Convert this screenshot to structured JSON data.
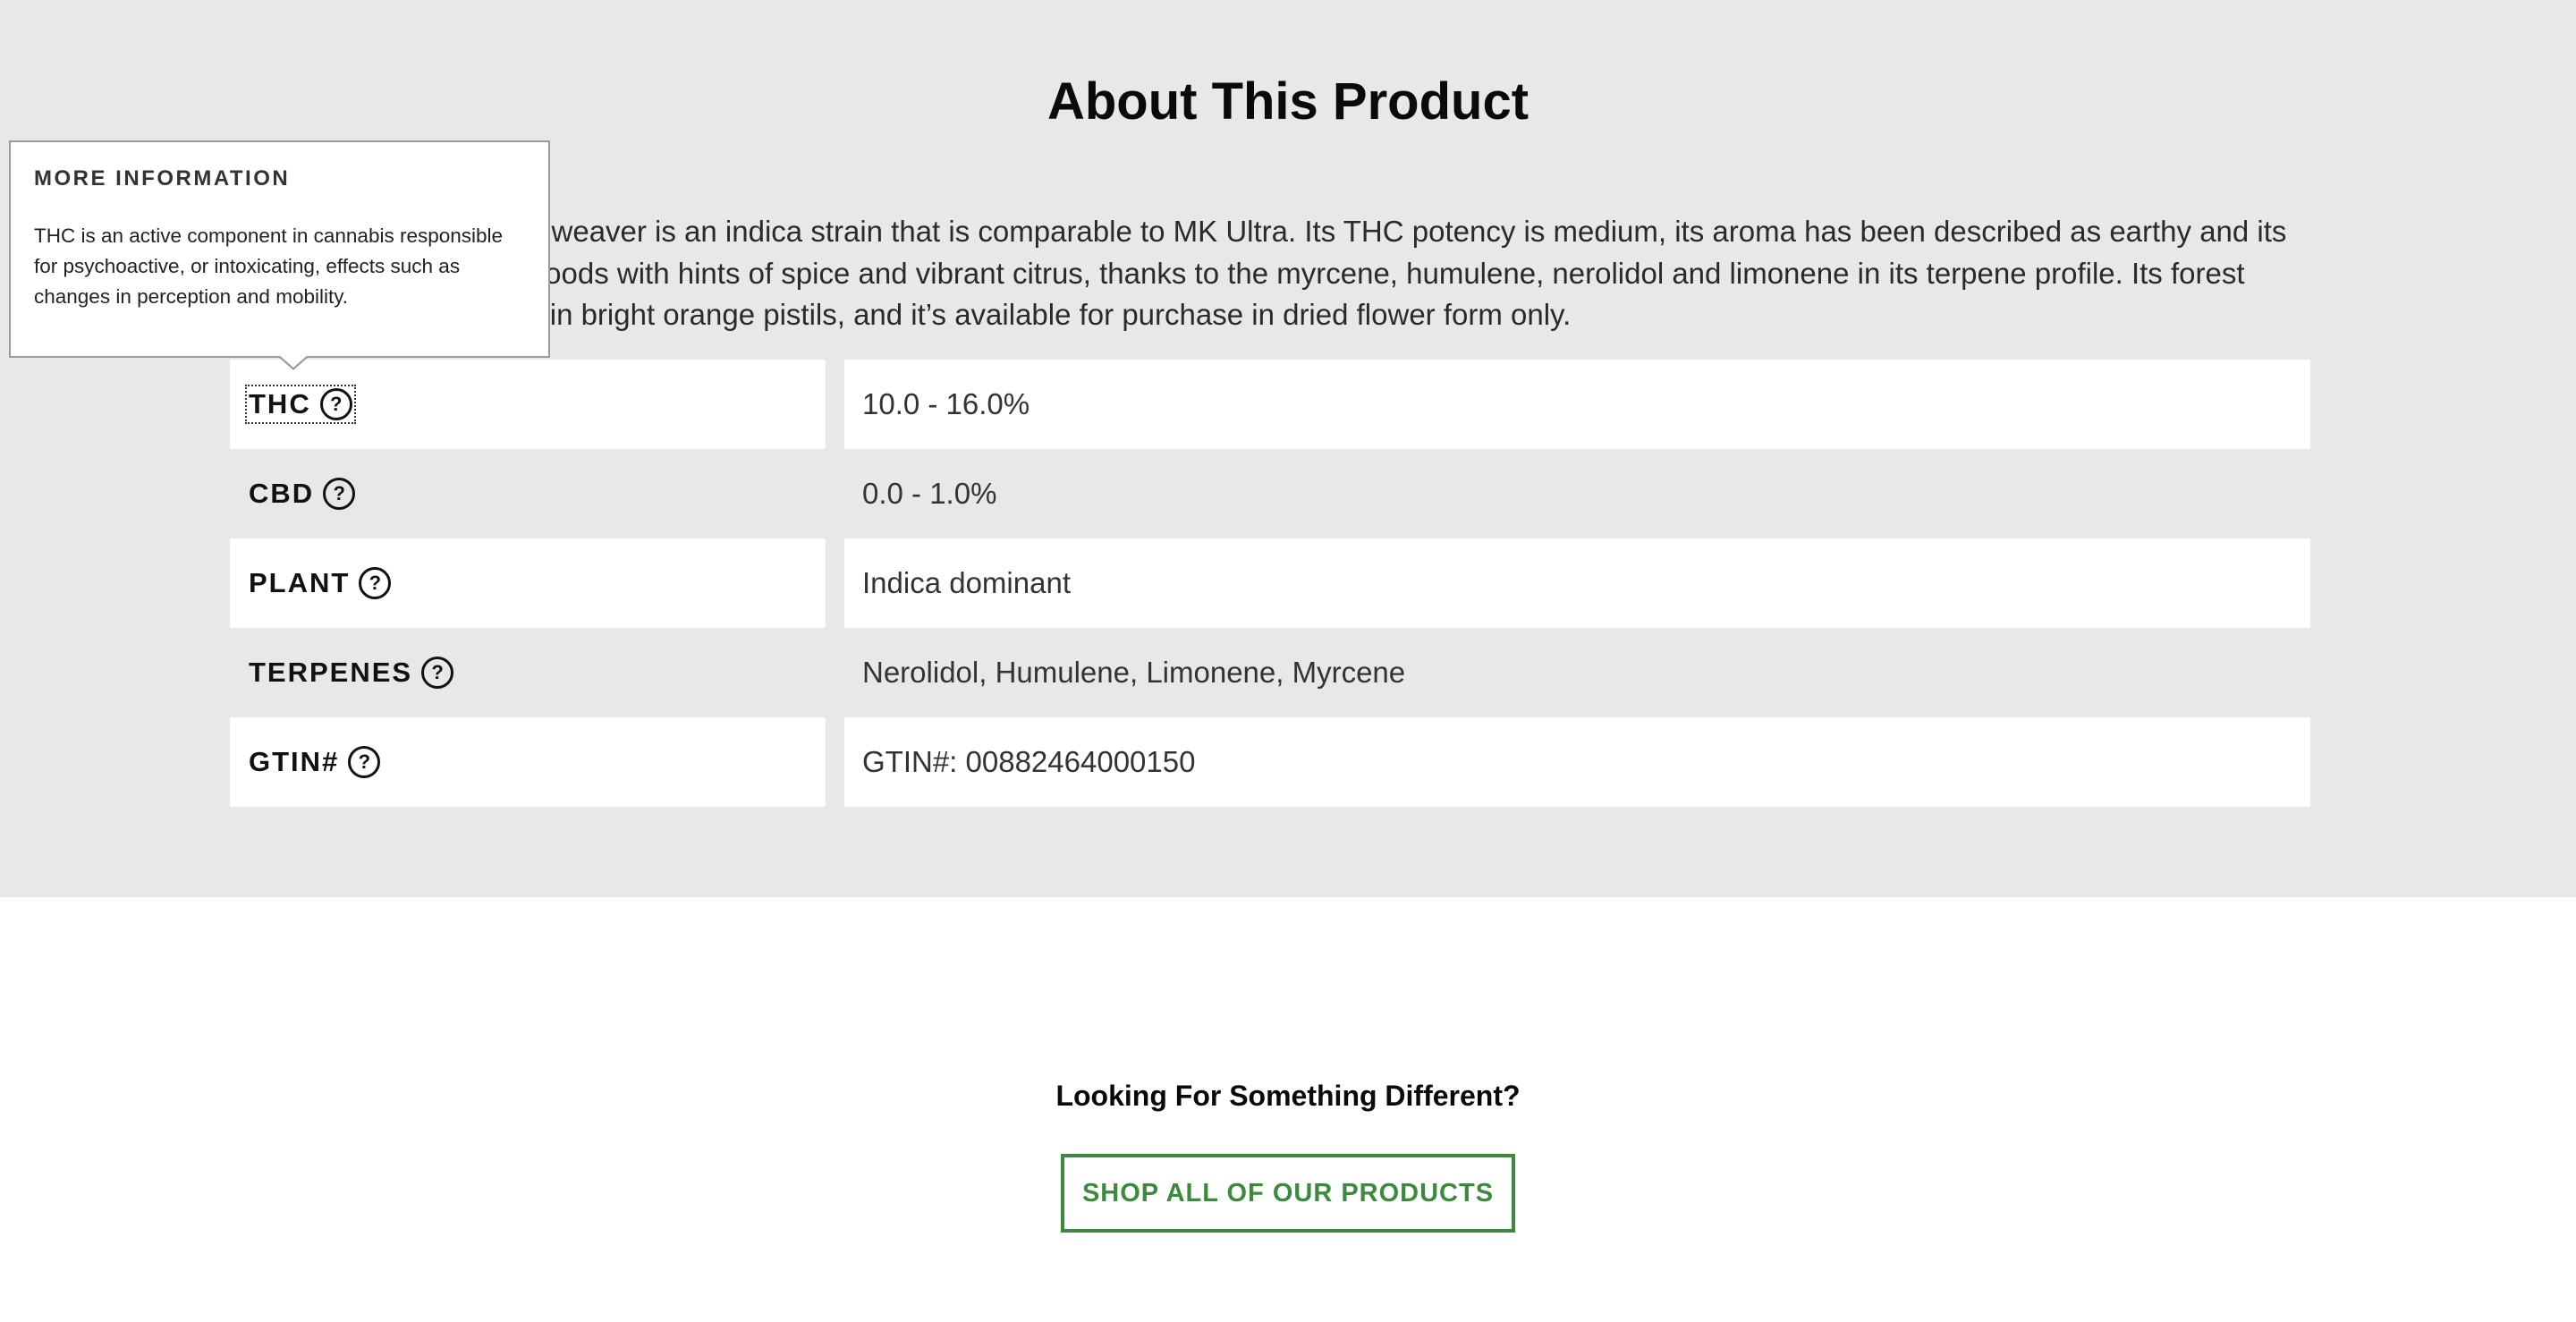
{
  "about": {
    "title": "About This Product",
    "description": "Indica dominant., Dreamweaver is an indica strain that is comparable to MK Ultra. Its THC potency is medium, its aroma has been described as earthy and its flavor combines piney woods with hints of spice and vibrant citrus, thanks to the myrcene, humulene, nerolidol and limonene in its terpene profile. Its forest green buds are covered in bright orange pistils, and it’s available for purchase in dried flower form only."
  },
  "attributes": [
    {
      "label": "THC",
      "value": "10.0 - 16.0%",
      "help_icon": "question-circle-icon"
    },
    {
      "label": "CBD",
      "value": "0.0 - 1.0%",
      "help_icon": "question-circle-icon"
    },
    {
      "label": "PLANT",
      "value": "Indica dominant",
      "help_icon": "question-circle-icon"
    },
    {
      "label": "TERPENES",
      "value": "Nerolidol, Humulene, Limonene, Myrcene",
      "help_icon": "question-circle-icon"
    },
    {
      "label": "GTIN#",
      "value": "GTIN#: 00882464000150",
      "help_icon": "question-circle-icon"
    }
  ],
  "help_icon_glyph": "?",
  "tooltip": {
    "title": "MORE INFORMATION",
    "text": "THC is an active component in cannabis responsible for psychoactive, or intoxicating, effects such as changes in perception and mobility."
  },
  "cta": {
    "heading": "Looking For Something Different?",
    "button_label": "SHOP ALL OF OUR PRODUCTS"
  },
  "colors": {
    "section_background": "#e8e8e8",
    "row_highlight": "#ffffff",
    "accent_green": "#3b8a3e"
  }
}
